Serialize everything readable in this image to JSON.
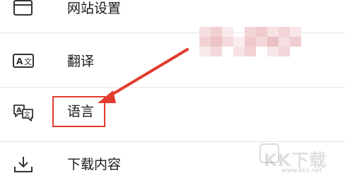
{
  "menu": {
    "items": [
      {
        "label": "网站设置",
        "icon": "website-settings-icon"
      },
      {
        "label": "翻译",
        "icon": "translate-icon"
      },
      {
        "label": "语言",
        "icon": "language-icon"
      },
      {
        "label": "下载内容",
        "icon": "download-icon"
      }
    ]
  },
  "annotation": {
    "highlighted_item": "语言",
    "color": "#e23b2e"
  },
  "watermark": {
    "text": "KK下载",
    "url": "www.kkx.net"
  }
}
